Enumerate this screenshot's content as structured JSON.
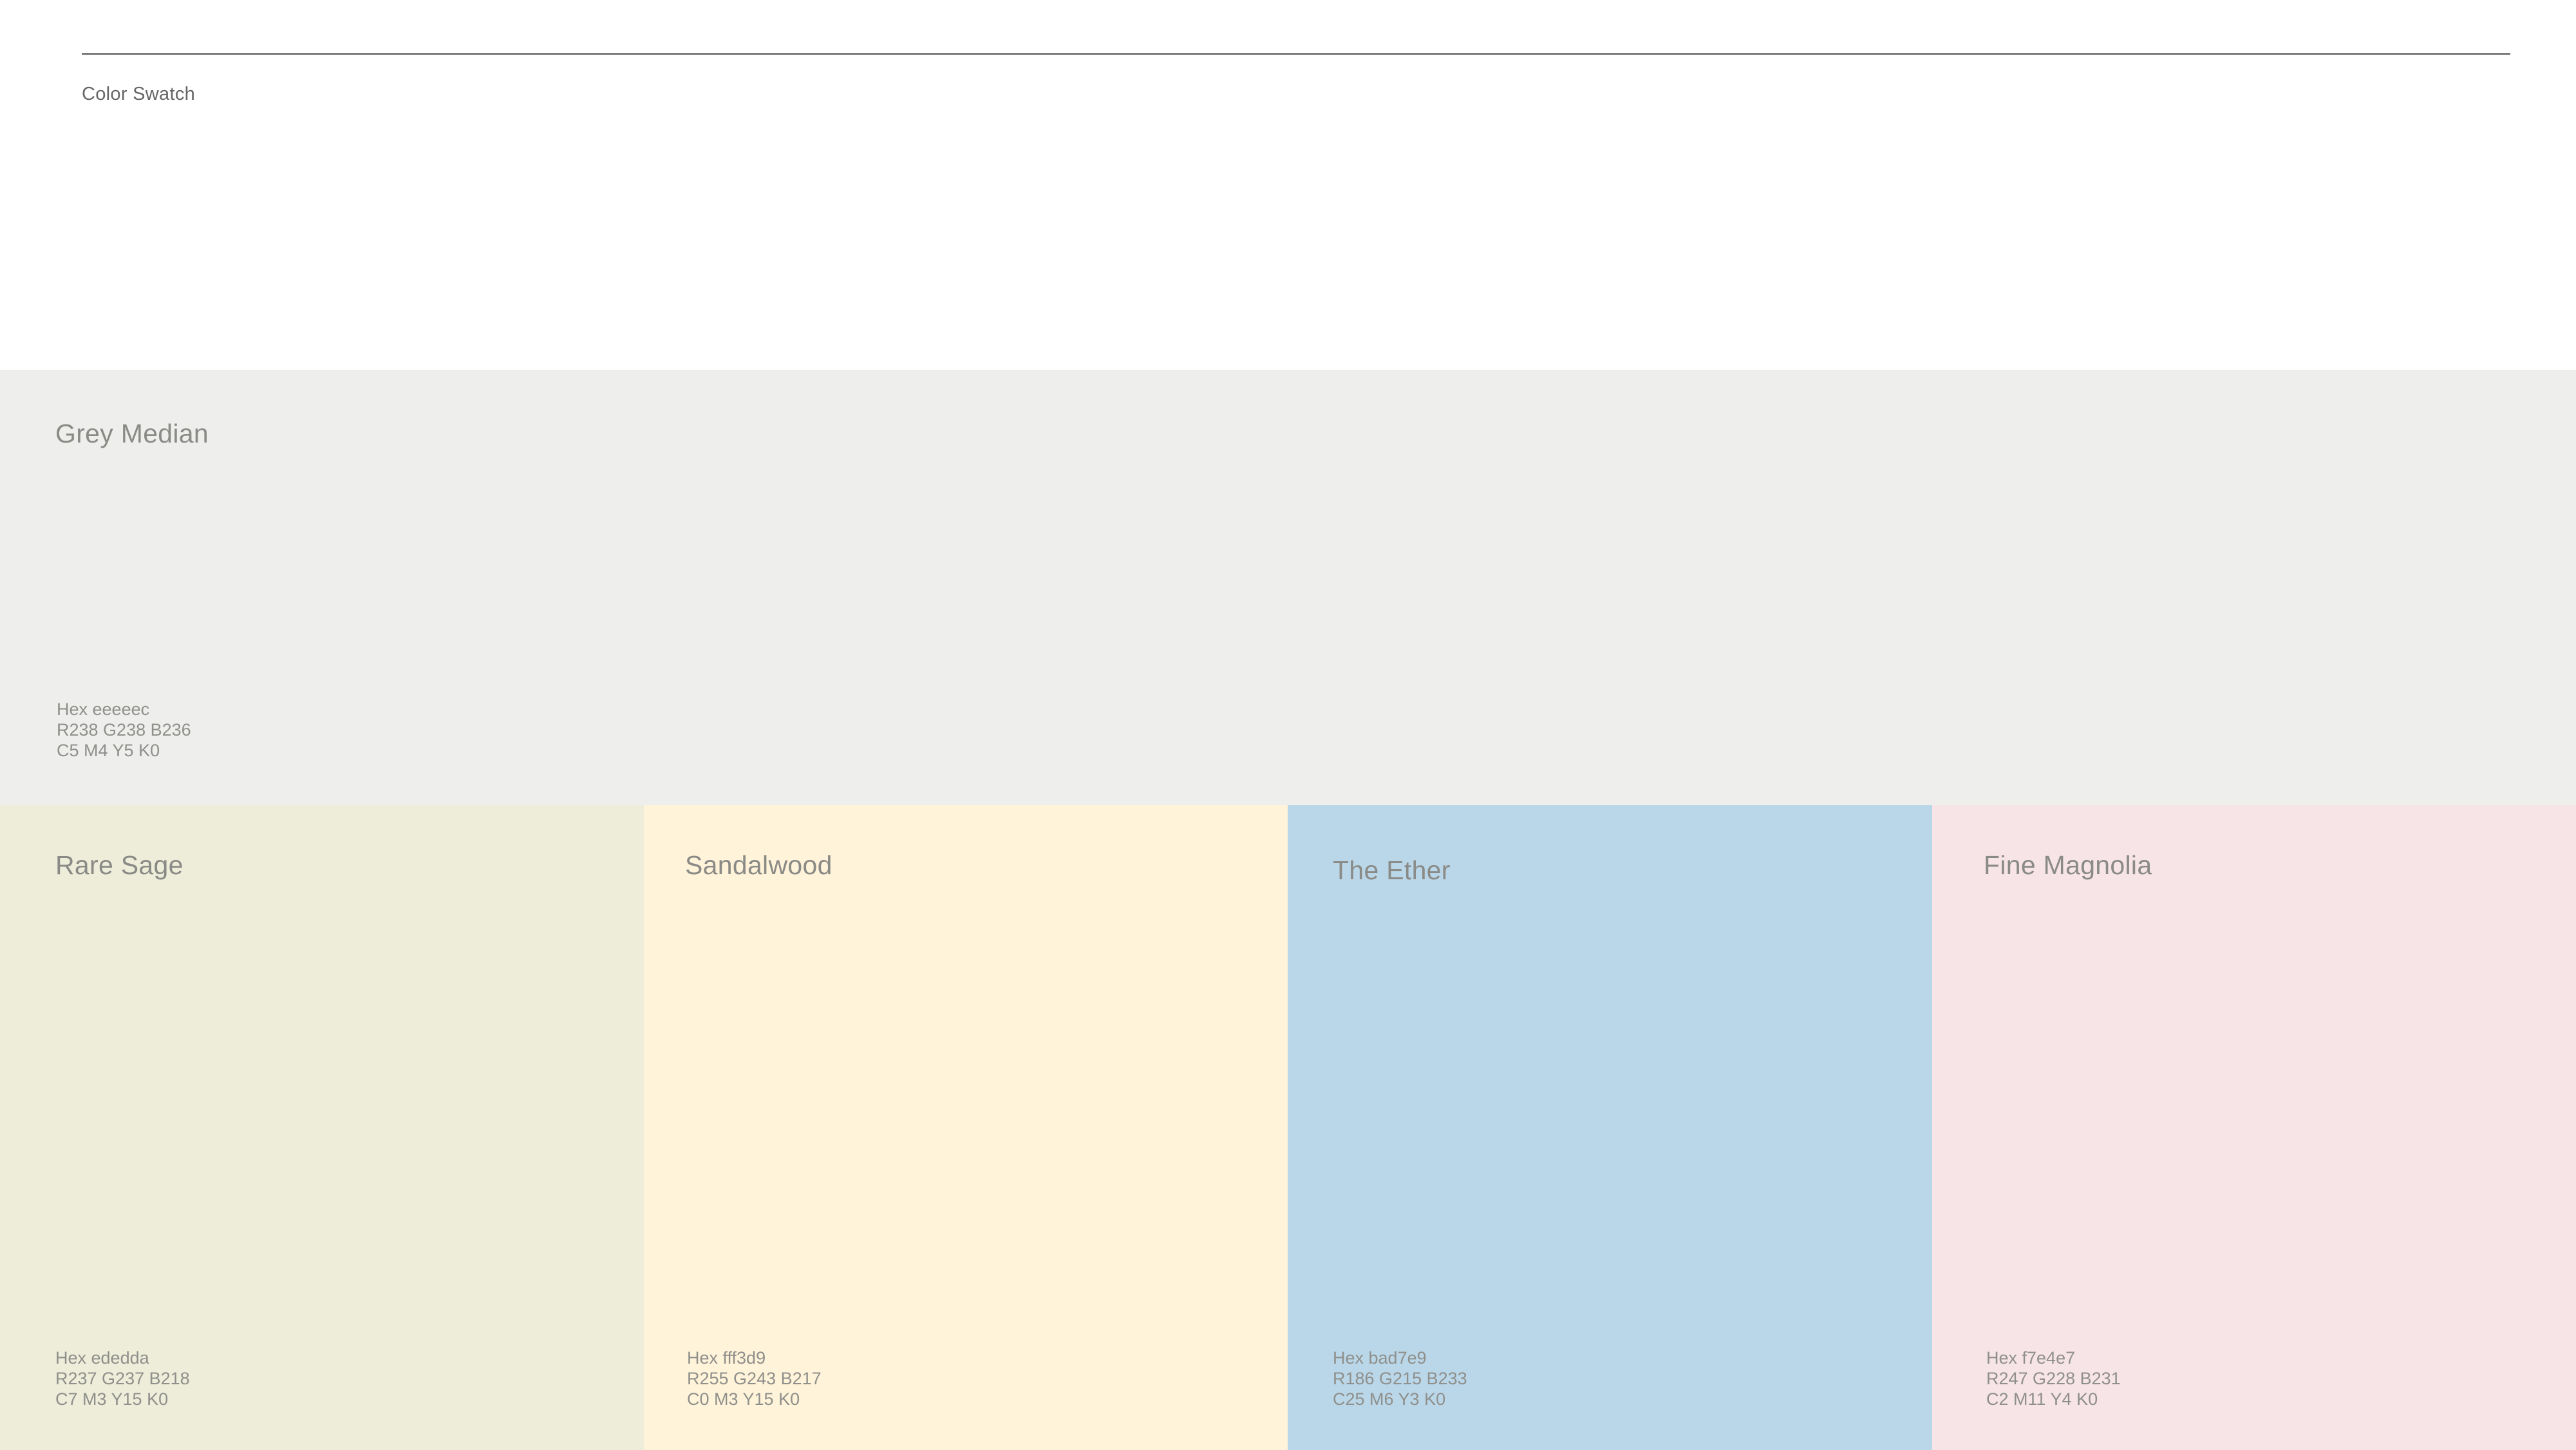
{
  "header": {
    "section_label": "Color Swatch"
  },
  "swatches": [
    {
      "name": "Grey Median",
      "color": "#eeeeec",
      "hex": "Hex eeeeec",
      "rgb": "R238 G238 B236",
      "cmyk": "C5 M4 Y5 K0"
    },
    {
      "name": "Rare Sage",
      "color": "#ededda",
      "hex": "Hex ededda",
      "rgb": "R237 G237 B218",
      "cmyk": "C7 M3 Y15 K0"
    },
    {
      "name": "Sandalwood",
      "color": "#fff3d9",
      "hex": "Hex fff3d9",
      "rgb": "R255 G243 B217",
      "cmyk": "C0 M3 Y15 K0"
    },
    {
      "name": "The Ether",
      "color": "#bad7e9",
      "hex": "Hex bad7e9",
      "rgb": "R186 G215 B233",
      "cmyk": "C25 M6 Y3 K0"
    },
    {
      "name": "Fine Magnolia",
      "color": "#f7e4e7",
      "hex": "Hex f7e4e7",
      "rgb": "R247 G228 B231",
      "cmyk": "C2 M11 Y4 K0"
    }
  ]
}
